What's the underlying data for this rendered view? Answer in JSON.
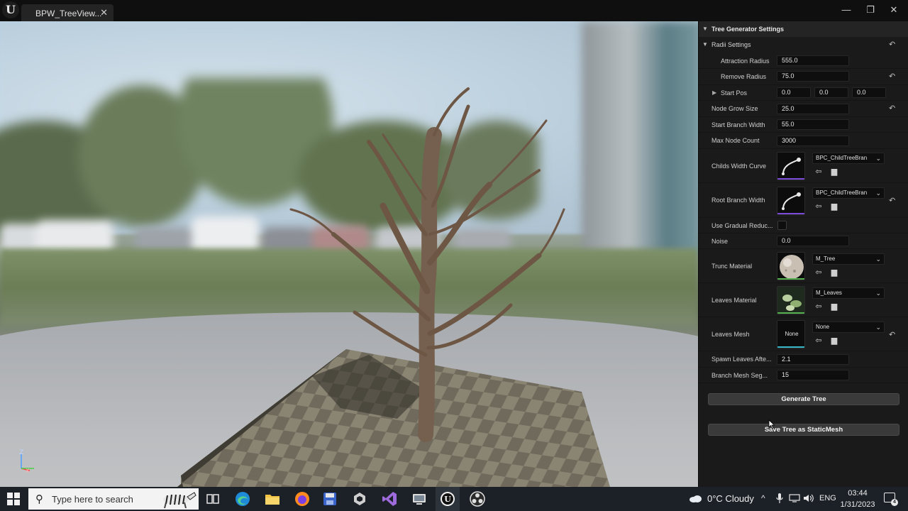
{
  "window": {
    "logo": "U",
    "tab_label": "BPW_TreeView...",
    "tab_close": "✕",
    "min_glyph": "—",
    "max_glyph": "❐",
    "close_glyph": "✕"
  },
  "viewport": {
    "gizmo_z": "Z",
    "gizmo_x": "X"
  },
  "details": {
    "section_title": "Tree Generator Settings",
    "radii_title": "Radii Settings",
    "caret_open": "▼",
    "caret_closed": "▶",
    "reset_glyph": "↶",
    "rows": {
      "attraction_radius": {
        "label": "Attraction Radius",
        "value": "555.0"
      },
      "remove_radius": {
        "label": "Remove Radius",
        "value": "75.0"
      },
      "start_pos": {
        "label": "Start Pos",
        "x": "0.0",
        "y": "0.0",
        "z": "0.0"
      },
      "node_grow_size": {
        "label": "Node Grow Size",
        "value": "25.0"
      },
      "start_branch_width": {
        "label": "Start Branch Width",
        "value": "55.0"
      },
      "max_node_count": {
        "label": "Max Node Count",
        "value": "3000"
      },
      "childs_width_curve": {
        "label": "Childs Width Curve",
        "asset": "BPC_ChildTreeBran"
      },
      "root_branch_width": {
        "label": "Root Branch Width",
        "asset": "BPC_ChildTreeBran"
      },
      "use_gradual_reduc": {
        "label": "Use Gradual Reduc...",
        "checked": false
      },
      "noise": {
        "label": "Noise",
        "value": "0.0"
      },
      "trunc_material": {
        "label": "Trunc Material",
        "asset": "M_Tree"
      },
      "leaves_material": {
        "label": "Leaves Material",
        "asset": "M_Leaves"
      },
      "leaves_mesh": {
        "label": "Leaves Mesh",
        "asset": "None",
        "thumb_text": "None"
      },
      "spawn_leaves_after": {
        "label": "Spawn Leaves Afte...",
        "value": "2.1"
      },
      "branch_mesh_seg": {
        "label": "Branch Mesh Seg...",
        "value": "15"
      }
    },
    "chevron": "⌄",
    "browse_glyph": "⇦",
    "folder_glyph": "▆",
    "generate_button": "Generate Tree",
    "save_button": "Save Tree as StaticMesh"
  },
  "taskbar": {
    "search_placeholder": "Type here to search",
    "search_glyph": "⚲",
    "weather": "0°C  Cloudy",
    "chevron_up": "^",
    "lang": "ENG",
    "time": "03:44",
    "date": "1/31/2023",
    "notification_count": "4"
  }
}
